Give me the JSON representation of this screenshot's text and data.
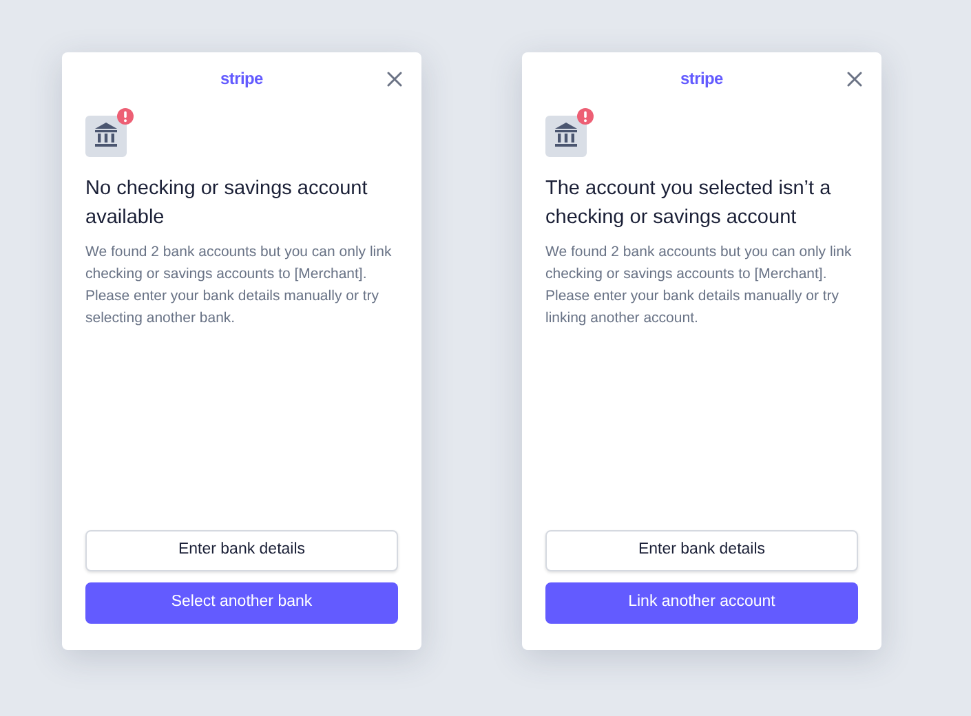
{
  "dialogs": [
    {
      "logo": "stripe",
      "title": "No checking or savings account available",
      "body": "We found 2 bank accounts but you can only link checking or savings accounts to [Merchant]. Please enter your bank details manually or try selecting another bank.",
      "buttons": [
        {
          "label": "Enter bank details",
          "kind": "secondary"
        },
        {
          "label": "Select another bank",
          "kind": "primary"
        }
      ]
    },
    {
      "logo": "stripe",
      "title": "The account you selected isn’t a checking or savings account",
      "body": "We found 2 bank accounts but you can only link checking or savings accounts to [Merchant]. Please enter your bank details manually or try linking another account.",
      "buttons": [
        {
          "label": "Enter bank details",
          "kind": "secondary"
        },
        {
          "label": "Link another account",
          "kind": "primary"
        }
      ]
    }
  ]
}
